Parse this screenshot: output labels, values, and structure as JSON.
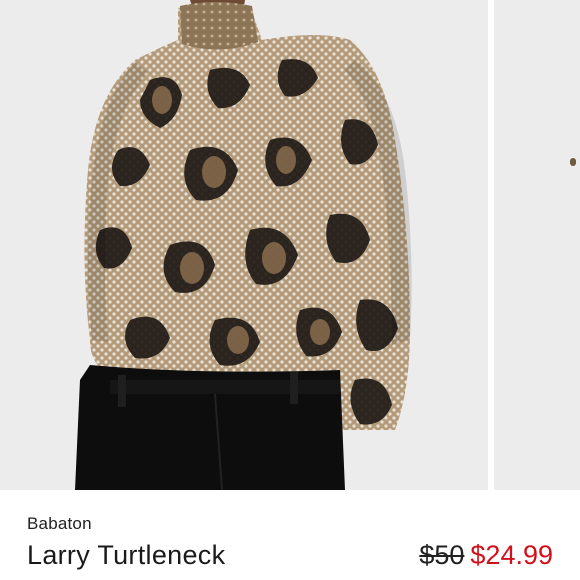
{
  "listing": {
    "brand": "Babaton",
    "title": "Larry Turtleneck",
    "price_original": "$50",
    "price_sale": "$24.99"
  },
  "colors": {
    "sale_price": "#d0111b",
    "photo_background": "#ececec"
  }
}
